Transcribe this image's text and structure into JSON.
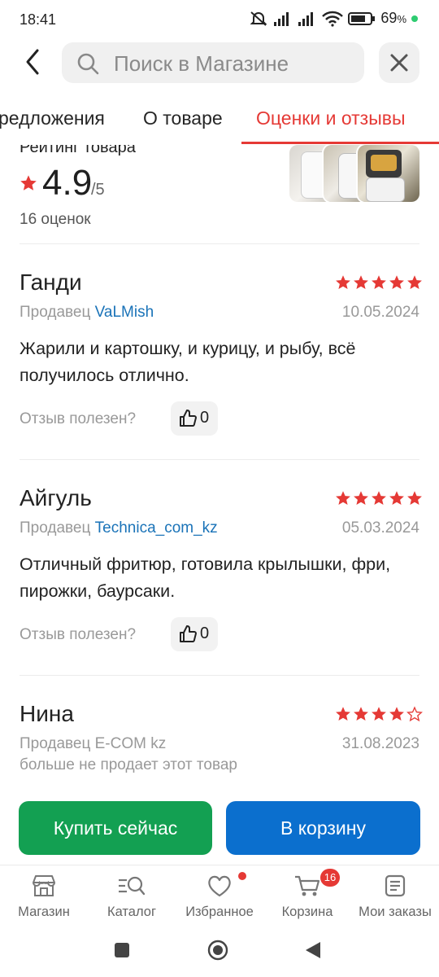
{
  "status_bar": {
    "time": "18:41",
    "battery": "69",
    "battery_unit": "%"
  },
  "search": {
    "placeholder": "Поиск в Магазине"
  },
  "tabs": [
    {
      "label": "редложения"
    },
    {
      "label": "О товаре"
    },
    {
      "label": "Оценки и отзывы"
    }
  ],
  "rating": {
    "caption": "Рейтинг товара",
    "value": "4.9",
    "max": "/5",
    "count_label": "16 оценок"
  },
  "reviews": [
    {
      "name": "Ганди",
      "stars": 5,
      "seller_prefix": "Продавец",
      "seller_name": "VaLMish",
      "date": "10.05.2024",
      "text": "Жарили и картошку, и курицу, и рыбу, всё получилось отлично.",
      "helpful_label": "Отзыв полезен?",
      "likes": "0"
    },
    {
      "name": "Айгуль",
      "stars": 5,
      "seller_prefix": "Продавец",
      "seller_name": "Technica_com_kz",
      "date": "05.03.2024",
      "text": "Отличный фритюр, готовила крылышки, фри, пирожки, баурсаки.",
      "helpful_label": "Отзыв полезен?",
      "likes": "0"
    },
    {
      "name": "Нина",
      "stars": 4,
      "seller_line": "Продавец E-COM kz",
      "seller_note": "больше не продает этот товар",
      "date": "31.08.2023"
    }
  ],
  "actions": {
    "buy_now": "Купить сейчас",
    "add_to_cart": "В корзину"
  },
  "bottom_nav": [
    {
      "label": "Магазин",
      "icon": "store-icon"
    },
    {
      "label": "Каталог",
      "icon": "catalog-search-icon"
    },
    {
      "label": "Избранное",
      "icon": "heart-icon"
    },
    {
      "label": "Корзина",
      "icon": "cart-icon",
      "badge": "16"
    },
    {
      "label": "Мои заказы",
      "icon": "orders-icon"
    }
  ],
  "colors": {
    "accent": "#e53935",
    "buy": "#13a052",
    "cart": "#0b6fce",
    "link": "#1a73b8"
  }
}
